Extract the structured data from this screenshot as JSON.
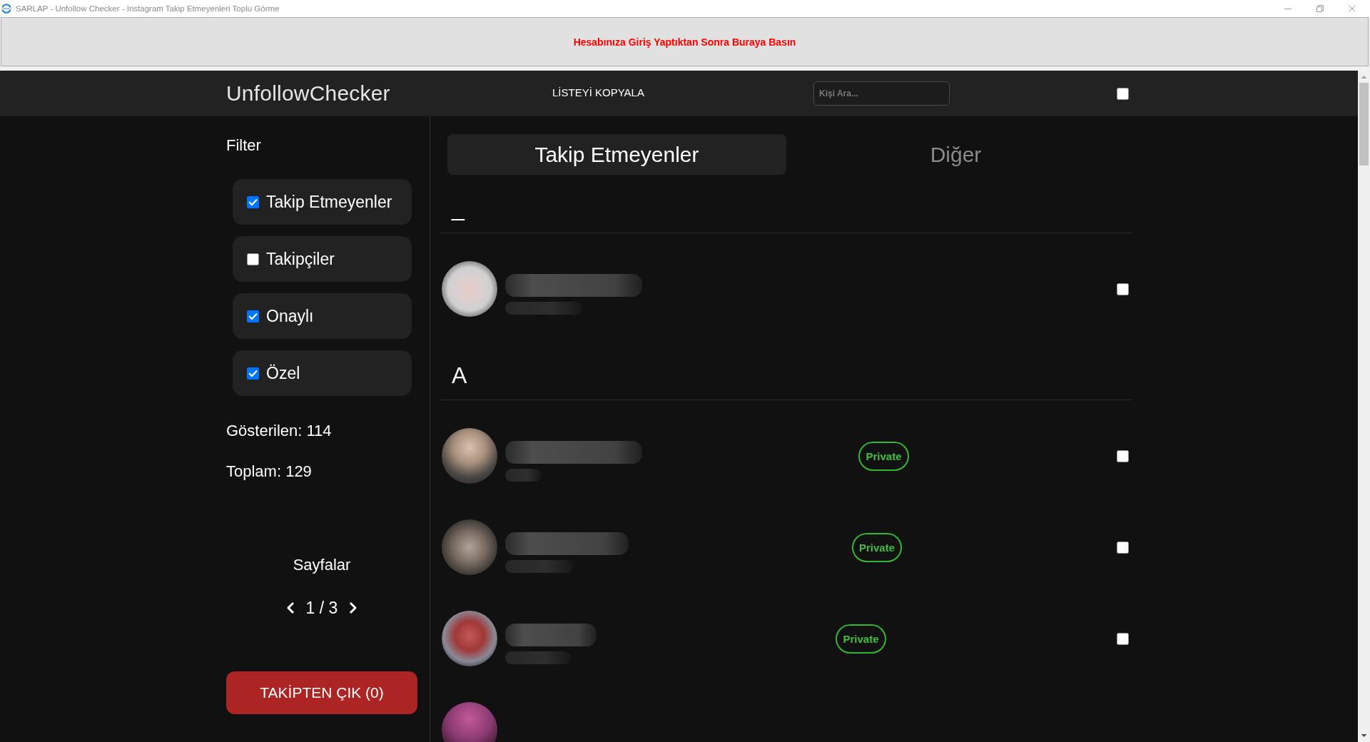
{
  "window": {
    "title": "SARLAP - Unfollow Checker - Instagram Takip Etmeyenleri Toplu Görme"
  },
  "banner": {
    "text": "Hesabınıza Giriş Yaptıktan Sonra Buraya Basın"
  },
  "header": {
    "logo": "UnfollowChecker",
    "copy_button": "LİSTEYİ KOPYALA",
    "search": {
      "placeholder": "Kişi Ara..."
    },
    "select_all": {
      "checked": false
    }
  },
  "sidebar": {
    "title": "Filter",
    "filters": [
      {
        "label": "Takip Etmeyenler",
        "checked": true
      },
      {
        "label": "Takipçiler",
        "checked": false
      },
      {
        "label": "Onaylı",
        "checked": true
      },
      {
        "label": "Özel",
        "checked": true
      }
    ],
    "shown": "Gösterilen: 114",
    "total": "Toplam: 129",
    "pages_label": "Sayfalar",
    "page": "1 / 3",
    "unfollow_button": "TAKİPTEN ÇIK (0)"
  },
  "tabs": [
    {
      "label": "Takip Etmeyenler",
      "selected": true
    },
    {
      "label": "Diğer",
      "selected": false
    }
  ],
  "groups": [
    {
      "letter": "_",
      "rows": [
        {
          "checked": false
        }
      ]
    },
    {
      "letter": "A",
      "rows": [
        {
          "badge": "Private",
          "checked": false
        },
        {
          "badge": "Private",
          "checked": false
        },
        {
          "badge": "Private",
          "checked": false
        },
        {}
      ]
    }
  ]
}
